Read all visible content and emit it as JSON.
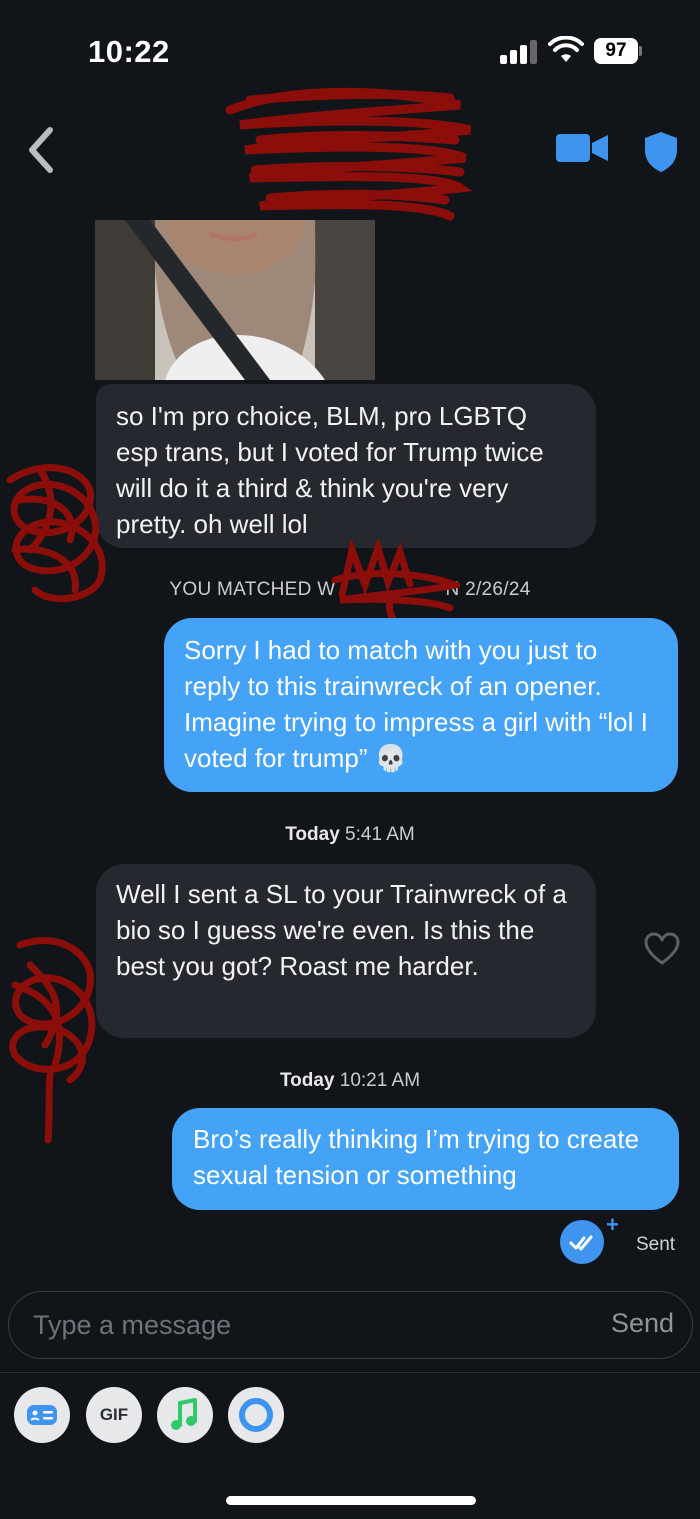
{
  "status_bar": {
    "time": "10:22",
    "battery": "97"
  },
  "header": {
    "name_redacted": true
  },
  "messages": [
    {
      "from": "them",
      "text": "so I'm pro choice, BLM, pro LGBTQ esp trans, but I voted for Trump twice will do it a third & think you're very pretty. oh well lol"
    },
    {
      "from": "me",
      "text": "Sorry I had to match with you just to reply to this trainwreck of an opener. Imagine trying to impress a girl with “lol I voted for trump” 💀"
    },
    {
      "from": "them",
      "text": "Well I sent a SL to your Trainwreck of a bio so I guess we're even. Is this the best you got? Roast me harder."
    },
    {
      "from": "me",
      "text": "Bro’s really thinking I’m trying to create sexual tension or something"
    }
  ],
  "matched_banner": {
    "left": "YOU MATCHED W",
    "right": "N 2/26/24"
  },
  "timestamps": [
    {
      "day": "Today",
      "time": "5:41 AM"
    },
    {
      "day": "Today",
      "time": "10:21 AM"
    }
  ],
  "sent_status": "Sent",
  "composer": {
    "placeholder": "Type a message",
    "send_label": "Send"
  },
  "toolbar": {
    "gif_label": "GIF"
  },
  "colors": {
    "accent": "#45a3f7",
    "background": "#111418",
    "incoming": "#25282e",
    "redaction": "#8b0e0a"
  }
}
